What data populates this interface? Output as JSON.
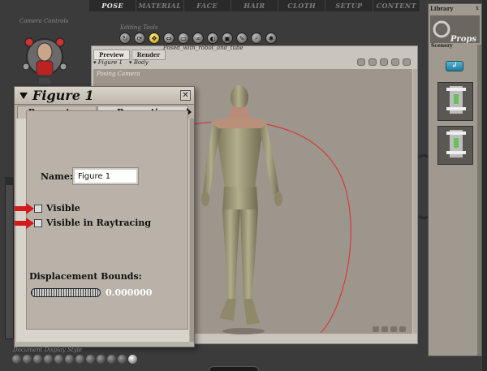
{
  "app": {
    "room_tabs": [
      "POSE",
      "MATERIAL",
      "FACE",
      "HAIR",
      "CLOTH",
      "SETUP",
      "CONTENT"
    ],
    "active_room": "POSE"
  },
  "camera_controls": {
    "label": "Camera Controls"
  },
  "editing_tools": {
    "label": "Editing Tools"
  },
  "document": {
    "title": "Posed_with_robot_and_tube",
    "tabs": [
      "Preview",
      "Render"
    ],
    "active_tab": "Preview",
    "figure_menu": "Figure 1",
    "body_menu": "Body",
    "camera_label": "Posing Camera"
  },
  "panel": {
    "title": "Figure 1",
    "tabs": [
      "Parameters",
      "Properties"
    ],
    "active_tab": "Properties",
    "name_label": "Name:",
    "name_value": "Figure 1",
    "visible_label": "Visible",
    "visible_checked": false,
    "raytrace_label": "Visible in Raytracing",
    "raytrace_checked": false,
    "displacement_label": "Displacement Bounds:",
    "displacement_value": "0.000000",
    "close_glyph": "✕"
  },
  "document_display": {
    "label": "Document Display Style"
  },
  "library": {
    "title": "Library",
    "close_glyph": "x",
    "category": "Props",
    "subcategory": "Scenery",
    "back_glyph": "↲"
  },
  "colors": {
    "arrow_red": "#d41a1a",
    "rotation_ring": "#d83a3a",
    "figure_skin": "#a39d7a"
  },
  "icons": {
    "tools": [
      "rotate-icon",
      "twist-icon",
      "translate-icon",
      "scale-icon",
      "taper-icon",
      "chain-icon",
      "color-icon",
      "grouping-icon",
      "direct-manipulation-icon",
      "view-magnifier-icon",
      "morph-brush-icon"
    ]
  }
}
